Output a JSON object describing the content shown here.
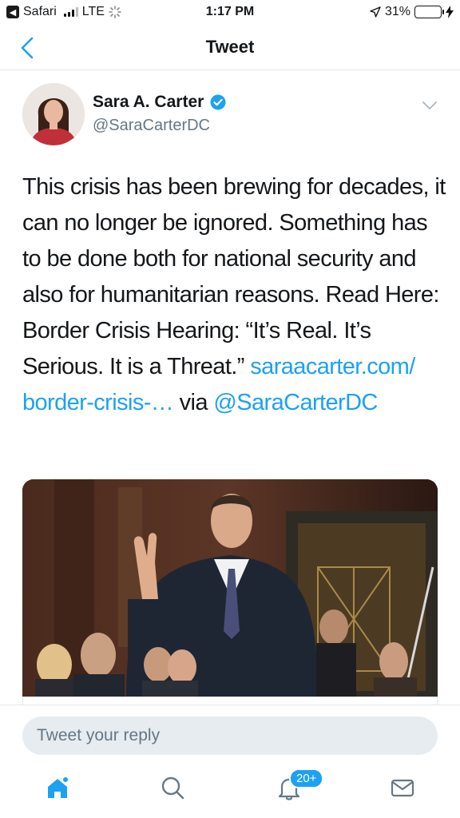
{
  "status_bar": {
    "back_app": "Safari",
    "network": "LTE",
    "time": "1:17 PM",
    "battery": "31%",
    "battery_level": 0.31
  },
  "nav": {
    "title": "Tweet"
  },
  "tweet": {
    "author_name": "Sara A. Carter",
    "author_handle": "@SaraCarterDC",
    "text_plain": "This crisis has been brewing for decades, it can no longer be ignored. Something has to be done both for national security and also for humanitarian reasons. Read Here: Border Crisis Hearing: “It’s Real. It’s Serious. It is a Threat.”",
    "link_text": "saraacarter.com/ border-crisis-…",
    "via_text": "via",
    "mention_text": "@SaraCarterDC"
  },
  "reply": {
    "placeholder": "Tweet your reply"
  },
  "tabs": {
    "notifications_badge": "20+"
  },
  "colors": {
    "accent": "#1da1f2",
    "secondary_text": "#657786",
    "battery_green": "#4cd964"
  }
}
